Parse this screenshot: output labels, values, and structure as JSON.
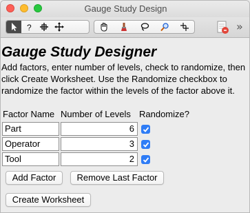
{
  "window": {
    "title": "Gauge Study Design"
  },
  "toolbar": {
    "tools": [
      {
        "icon": "arrow-pointer-icon"
      },
      {
        "icon": "help-question-icon"
      },
      {
        "icon": "crosshair-select-icon"
      },
      {
        "icon": "move-arrows-icon"
      },
      {
        "icon": "hand-grabber-icon"
      },
      {
        "icon": "brush-icon"
      },
      {
        "icon": "lasso-icon"
      },
      {
        "icon": "magnifier-icon"
      },
      {
        "icon": "crosshairs-icon"
      }
    ],
    "expand_glyph": "»"
  },
  "main": {
    "heading": "Gauge Study Designer",
    "description": "Add factors, enter number of levels, check to randomize, then click Create Worksheet. Use the Randomize checkbox to randomize the factor within the levels of the factor above it.",
    "columns": {
      "factor_name": "Factor Name",
      "levels": "Number of Levels",
      "randomize": "Randomize?"
    },
    "factors": [
      {
        "name": "Part",
        "levels": "6",
        "randomize": true
      },
      {
        "name": "Operator",
        "levels": "3",
        "randomize": true
      },
      {
        "name": "Tool",
        "levels": "2",
        "randomize": true
      }
    ],
    "buttons": {
      "add_factor": "Add Factor",
      "remove_last": "Remove Last Factor",
      "create_worksheet": "Create Worksheet"
    }
  },
  "colors": {
    "accent": "#2e7cf6"
  }
}
